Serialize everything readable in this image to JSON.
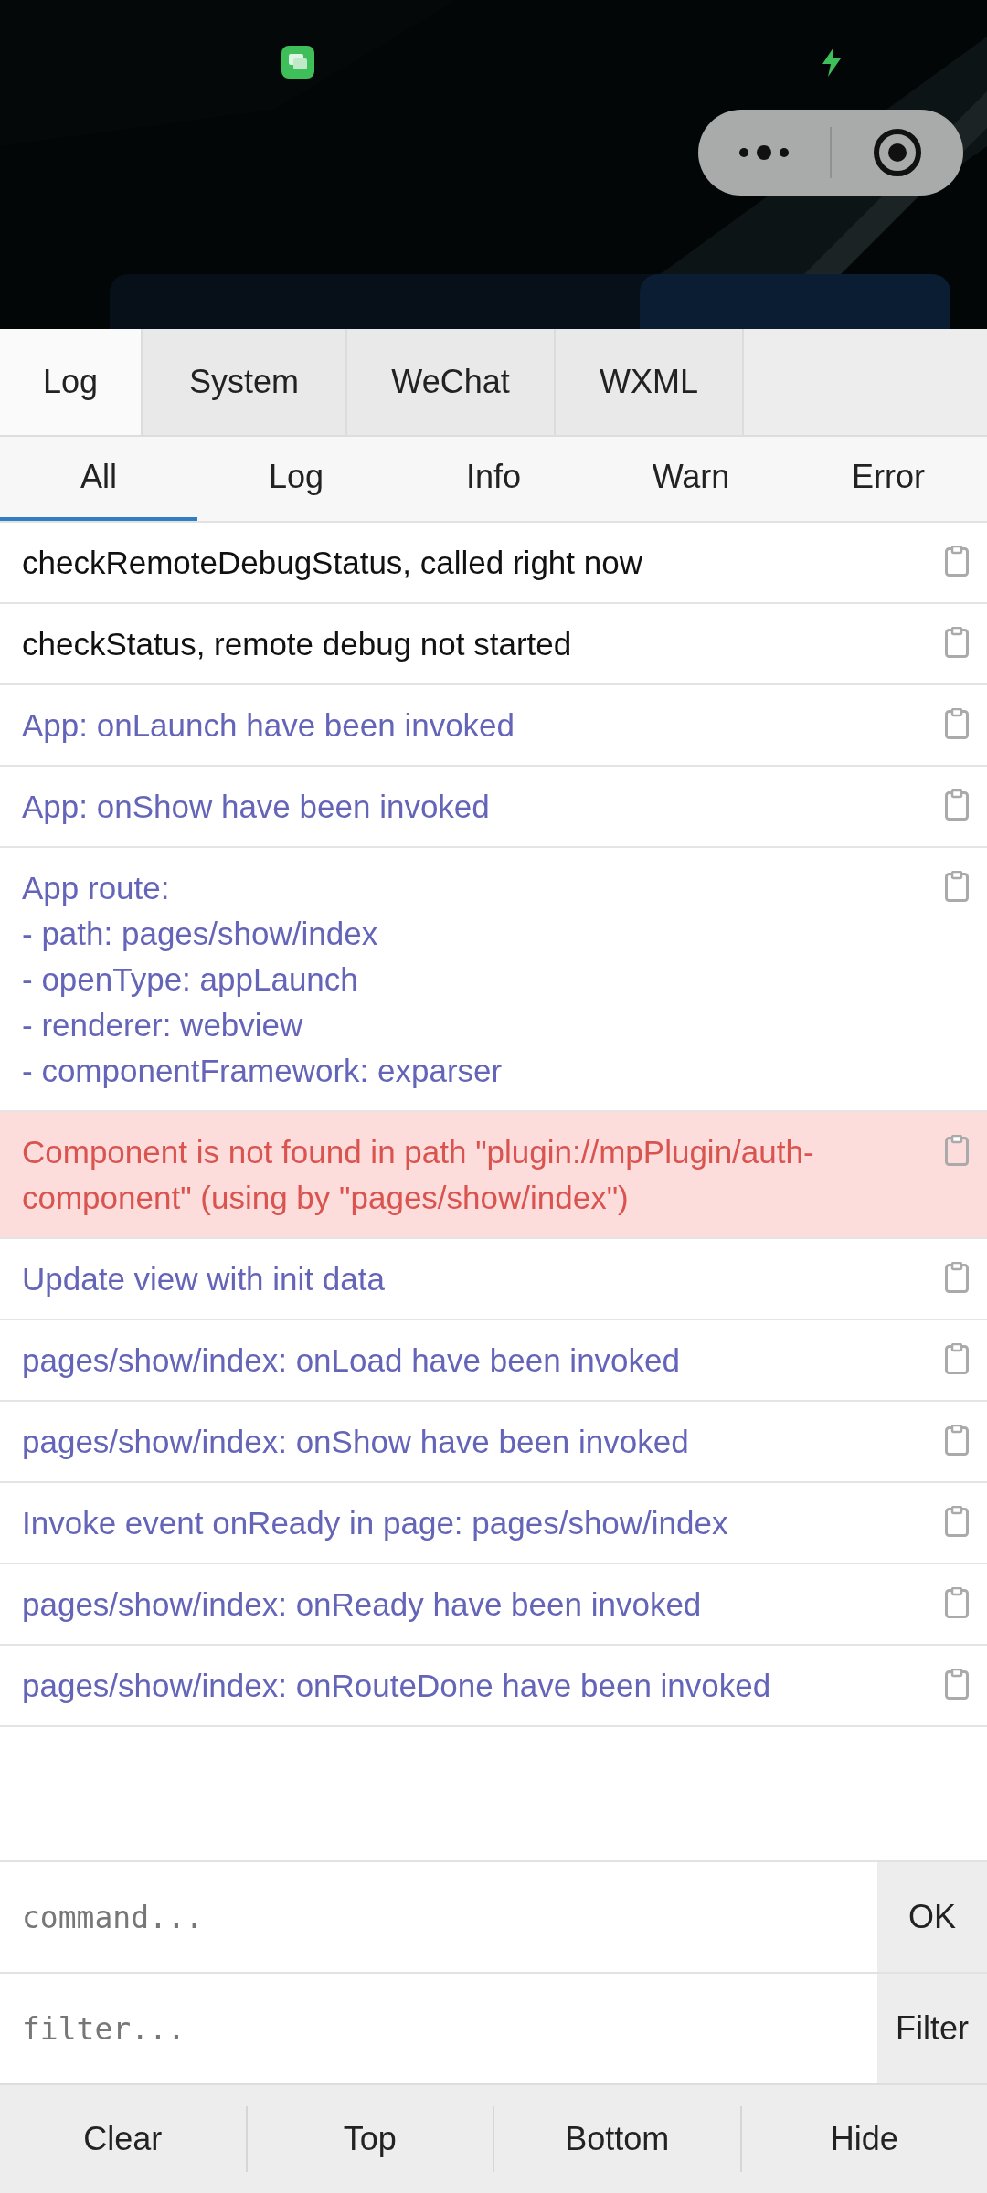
{
  "tabs": [
    {
      "label": "Log",
      "selected": true
    },
    {
      "label": "System",
      "selected": false
    },
    {
      "label": "WeChat",
      "selected": false
    },
    {
      "label": "WXML",
      "selected": false
    }
  ],
  "levels": [
    {
      "label": "All",
      "selected": true
    },
    {
      "label": "Log",
      "selected": false
    },
    {
      "label": "Info",
      "selected": false
    },
    {
      "label": "Warn",
      "selected": false
    },
    {
      "label": "Error",
      "selected": false
    }
  ],
  "logs": [
    {
      "kind": "log",
      "text": "checkRemoteDebugStatus, called right now"
    },
    {
      "kind": "log",
      "text": "checkStatus, remote debug not started"
    },
    {
      "kind": "info",
      "text": "App: onLaunch have been invoked"
    },
    {
      "kind": "info",
      "text": "App: onShow have been invoked"
    },
    {
      "kind": "info",
      "text": "App route:\n- path: pages/show/index\n- openType: appLaunch\n- renderer: webview\n- componentFramework: exparser"
    },
    {
      "kind": "error",
      "text": "Component is not found in path \"plugin://mpPlugin/auth-component\" (using by \"pages/show/index\")"
    },
    {
      "kind": "info",
      "text": "Update view with init data"
    },
    {
      "kind": "info",
      "text": "pages/show/index: onLoad have been invoked"
    },
    {
      "kind": "info",
      "text": "pages/show/index: onShow have been invoked"
    },
    {
      "kind": "info",
      "text": "Invoke event onReady in page: pages/show/index"
    },
    {
      "kind": "info",
      "text": "pages/show/index: onReady have been invoked"
    },
    {
      "kind": "info",
      "text": "pages/show/index: onRouteDone have been invoked"
    }
  ],
  "command": {
    "placeholder": "command...",
    "button": "OK"
  },
  "filter": {
    "placeholder": "filter...",
    "button": "Filter"
  },
  "toolbar": [
    "Clear",
    "Top",
    "Bottom",
    "Hide"
  ]
}
